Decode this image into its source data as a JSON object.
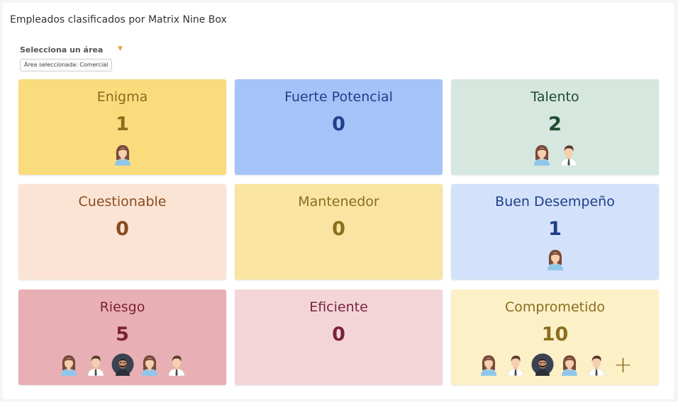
{
  "page": {
    "title": "Empleados clasificados por Matrix Nine Box"
  },
  "area_selector": {
    "label": "Selecciona un área",
    "selected_chip": "Área seleccionada: Comercial"
  },
  "boxes": [
    {
      "label": "Enigma",
      "count": "1",
      "bg": "#fadc7d",
      "label_color": "#8a6d1e",
      "count_color": "#8a6d1e",
      "avatars": [
        "woman"
      ]
    },
    {
      "label": "Fuerte Potencial",
      "count": "0",
      "bg": "#a6c3f9",
      "label_color": "#1f3f88",
      "count_color": "#1f3f88",
      "avatars": []
    },
    {
      "label": "Talento",
      "count": "2",
      "bg": "#d5e7de",
      "label_color": "#1f4a30",
      "count_color": "#1f4a30",
      "avatars": [
        "woman",
        "man"
      ]
    },
    {
      "label": "Cuestionable",
      "count": "0",
      "bg": "#fbe4d4",
      "label_color": "#8a4a1e",
      "count_color": "#8a4a1e",
      "avatars": []
    },
    {
      "label": "Mantenedor",
      "count": "0",
      "bg": "#f9e4a2",
      "label_color": "#8a6d1e",
      "count_color": "#8a6d1e",
      "avatars": []
    },
    {
      "label": "Buen Desempeño",
      "count": "1",
      "bg": "#d3e1fa",
      "label_color": "#1f3f88",
      "count_color": "#1f3f88",
      "avatars": [
        "woman"
      ]
    },
    {
      "label": "Riesgo",
      "count": "5",
      "bg": "#e8b0b5",
      "label_color": "#7a2230",
      "count_color": "#7a2230",
      "avatars": [
        "woman",
        "man",
        "bearded",
        "woman",
        "man"
      ]
    },
    {
      "label": "Eficiente",
      "count": "0",
      "bg": "#f3d5d8",
      "label_color": "#7a2240",
      "count_color": "#7a2240",
      "avatars": []
    },
    {
      "label": "Comprometido",
      "count": "10",
      "bg": "#fcf0c7",
      "label_color": "#8a6d1e",
      "count_color": "#8a6d1e",
      "avatars": [
        "woman",
        "man",
        "bearded",
        "woman",
        "man"
      ],
      "more_icon": "plus-icon"
    }
  ]
}
